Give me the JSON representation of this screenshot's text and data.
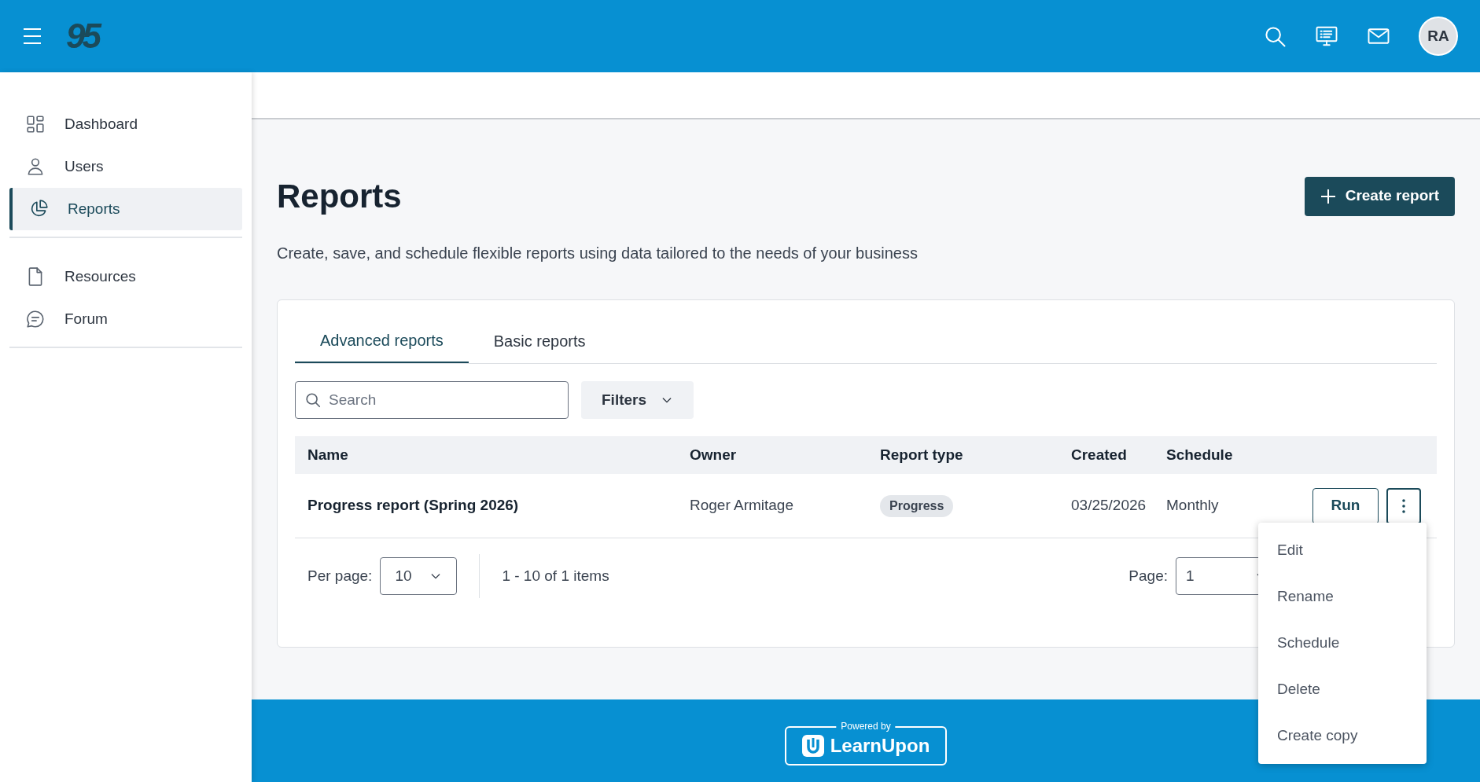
{
  "header": {
    "logo": "95",
    "avatar": "RA"
  },
  "sidebar": {
    "sections": [
      {
        "items": [
          {
            "label": "Dashboard",
            "kind": "dashboard",
            "selected": false
          },
          {
            "label": "Users",
            "kind": "user",
            "selected": false
          },
          {
            "label": "Reports",
            "kind": "pie",
            "selected": true
          }
        ]
      },
      {
        "items": [
          {
            "label": "Resources",
            "kind": "file",
            "selected": false
          },
          {
            "label": "Forum",
            "kind": "chat",
            "selected": false
          }
        ]
      }
    ]
  },
  "page": {
    "title": "Reports",
    "subtitle": "Create, save, and schedule flexible reports using data tailored to the needs of your business",
    "create_button": "Create report"
  },
  "tabs": [
    {
      "label": "Advanced reports",
      "selected": true
    },
    {
      "label": "Basic reports",
      "selected": false
    }
  ],
  "search": {
    "placeholder": "Search"
  },
  "filters_button": "Filters",
  "table": {
    "columns": [
      "Name",
      "Owner",
      "Report type",
      "Created",
      "Schedule"
    ],
    "rows": [
      {
        "name": "Progress report (Spring 2026)",
        "owner": "Roger Armitage",
        "report_type": "Progress",
        "created": "03/25/2026",
        "schedule": "Monthly",
        "run_button": "Run",
        "menu_open": true
      }
    ]
  },
  "pagination": {
    "per_page_label": "Per page:",
    "per_page": "10",
    "range": "1 - 10 of 1 items",
    "page_label": "Page:",
    "page": "1"
  },
  "row_menu": {
    "items": [
      "Edit",
      "Rename",
      "Schedule",
      "Delete",
      "Create copy"
    ]
  },
  "footer": {
    "powered_by": "Powered by",
    "brand": "LearnUpon"
  }
}
